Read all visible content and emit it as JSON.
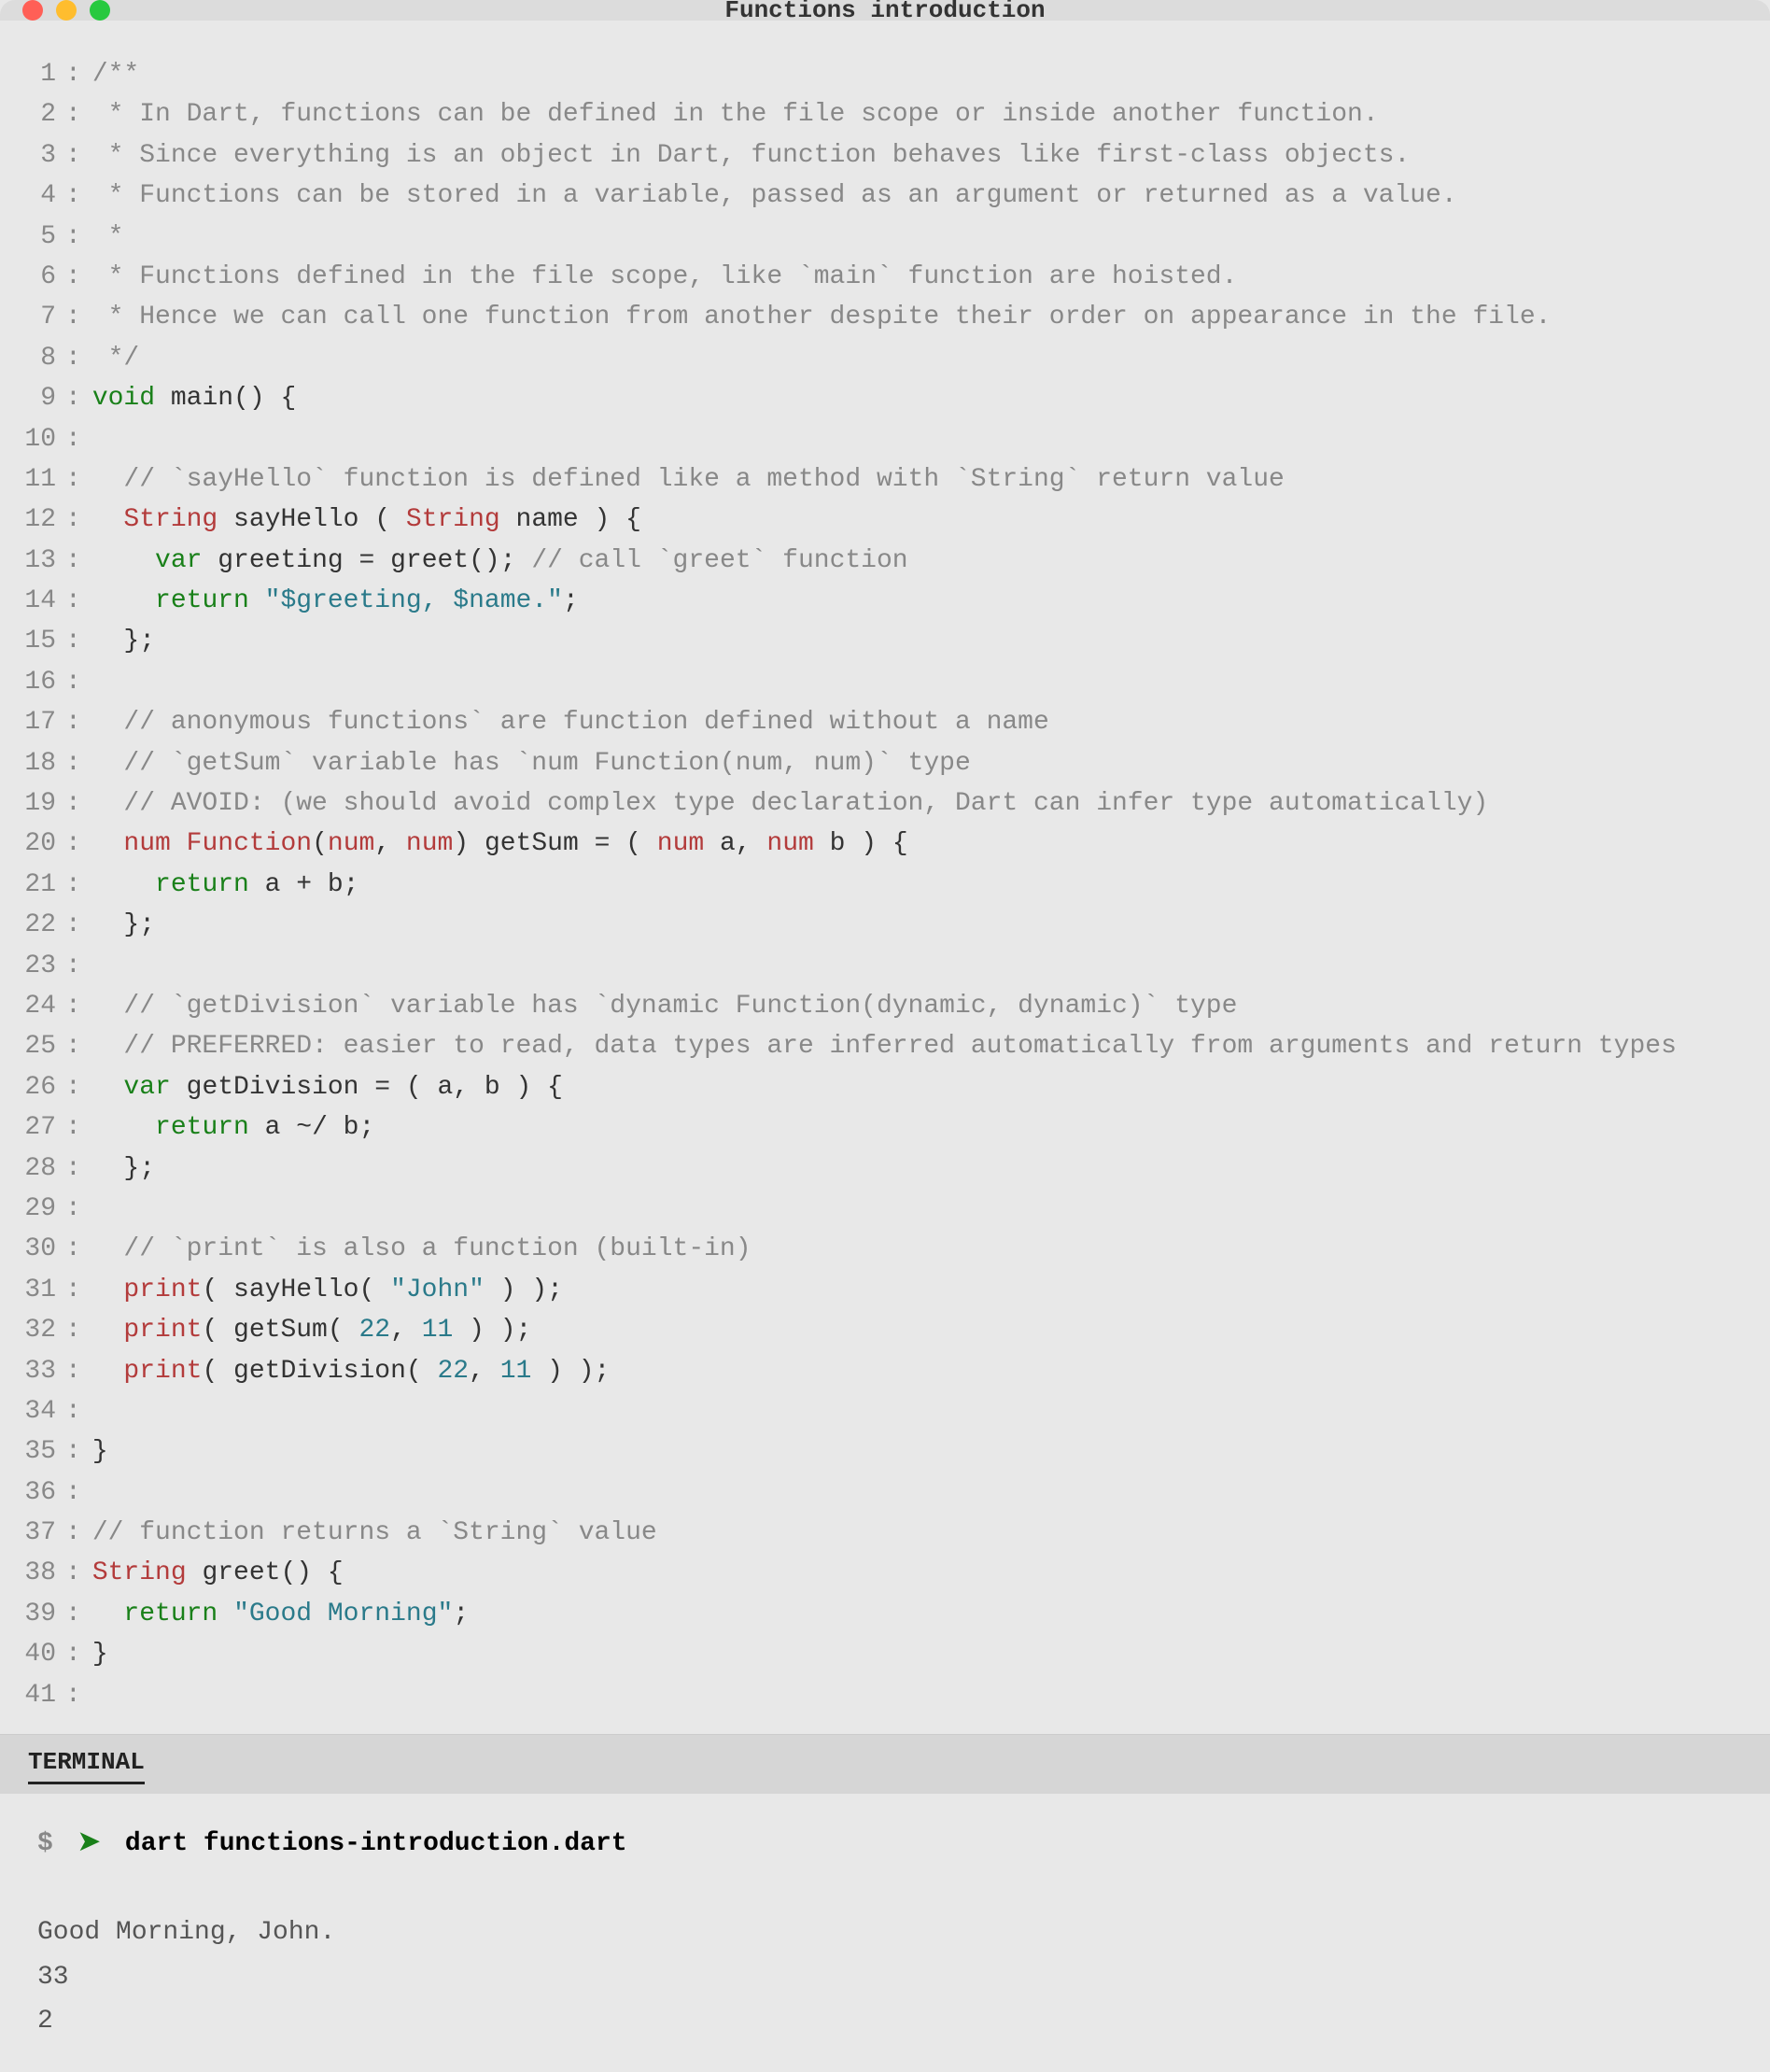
{
  "window": {
    "title": "Functions introduction"
  },
  "code": [
    {
      "n": 1,
      "tokens": [
        [
          "comment",
          "/**"
        ]
      ]
    },
    {
      "n": 2,
      "tokens": [
        [
          "comment",
          " * In Dart, functions can be defined in the file scope or inside another function."
        ]
      ]
    },
    {
      "n": 3,
      "tokens": [
        [
          "comment",
          " * Since everything is an object in Dart, function behaves like first-class objects."
        ]
      ]
    },
    {
      "n": 4,
      "tokens": [
        [
          "comment",
          " * Functions can be stored in a variable, passed as an argument or returned as a value."
        ]
      ]
    },
    {
      "n": 5,
      "tokens": [
        [
          "comment",
          " *"
        ]
      ]
    },
    {
      "n": 6,
      "tokens": [
        [
          "comment",
          " * Functions defined in the file scope, like `main` function are hoisted."
        ]
      ]
    },
    {
      "n": 7,
      "tokens": [
        [
          "comment",
          " * Hence we can call one function from another despite their order on appearance in the file."
        ]
      ]
    },
    {
      "n": 8,
      "tokens": [
        [
          "comment",
          " */"
        ]
      ]
    },
    {
      "n": 9,
      "tokens": [
        [
          "keyword",
          "void"
        ],
        [
          "plain",
          " main() {"
        ]
      ]
    },
    {
      "n": 10,
      "tokens": []
    },
    {
      "n": 11,
      "tokens": [
        [
          "plain",
          "  "
        ],
        [
          "comment",
          "// `sayHello` function is defined like a method with `String` return value"
        ]
      ]
    },
    {
      "n": 12,
      "tokens": [
        [
          "plain",
          "  "
        ],
        [
          "type",
          "String"
        ],
        [
          "plain",
          " sayHello ( "
        ],
        [
          "type",
          "String"
        ],
        [
          "plain",
          " name ) {"
        ]
      ]
    },
    {
      "n": 13,
      "tokens": [
        [
          "plain",
          "    "
        ],
        [
          "keyword",
          "var"
        ],
        [
          "plain",
          " greeting = greet(); "
        ],
        [
          "comment",
          "// call `greet` function"
        ]
      ]
    },
    {
      "n": 14,
      "tokens": [
        [
          "plain",
          "    "
        ],
        [
          "keyword",
          "return"
        ],
        [
          "plain",
          " "
        ],
        [
          "string",
          "\"$greeting, $name.\""
        ],
        [
          "plain",
          ";"
        ]
      ]
    },
    {
      "n": 15,
      "tokens": [
        [
          "plain",
          "  };"
        ]
      ]
    },
    {
      "n": 16,
      "tokens": []
    },
    {
      "n": 17,
      "tokens": [
        [
          "plain",
          "  "
        ],
        [
          "comment",
          "// anonymous functions` are function defined without a name"
        ]
      ]
    },
    {
      "n": 18,
      "tokens": [
        [
          "plain",
          "  "
        ],
        [
          "comment",
          "// `getSum` variable has `num Function(num, num)` type"
        ]
      ]
    },
    {
      "n": 19,
      "tokens": [
        [
          "plain",
          "  "
        ],
        [
          "comment",
          "// AVOID: (we should avoid complex type declaration, Dart can infer type automatically)"
        ]
      ]
    },
    {
      "n": 20,
      "tokens": [
        [
          "plain",
          "  "
        ],
        [
          "type",
          "num"
        ],
        [
          "plain",
          " "
        ],
        [
          "type",
          "Function"
        ],
        [
          "plain",
          "("
        ],
        [
          "type",
          "num"
        ],
        [
          "plain",
          ", "
        ],
        [
          "type",
          "num"
        ],
        [
          "plain",
          ") getSum = ( "
        ],
        [
          "type",
          "num"
        ],
        [
          "plain",
          " a, "
        ],
        [
          "type",
          "num"
        ],
        [
          "plain",
          " b ) {"
        ]
      ]
    },
    {
      "n": 21,
      "tokens": [
        [
          "plain",
          "    "
        ],
        [
          "keyword",
          "return"
        ],
        [
          "plain",
          " a + b;"
        ]
      ]
    },
    {
      "n": 22,
      "tokens": [
        [
          "plain",
          "  };"
        ]
      ]
    },
    {
      "n": 23,
      "tokens": []
    },
    {
      "n": 24,
      "tokens": [
        [
          "plain",
          "  "
        ],
        [
          "comment",
          "// `getDivision` variable has `dynamic Function(dynamic, dynamic)` type"
        ]
      ]
    },
    {
      "n": 25,
      "tokens": [
        [
          "plain",
          "  "
        ],
        [
          "comment",
          "// PREFERRED: easier to read, data types are inferred automatically from arguments and return types"
        ]
      ]
    },
    {
      "n": 26,
      "tokens": [
        [
          "plain",
          "  "
        ],
        [
          "keyword",
          "var"
        ],
        [
          "plain",
          " getDivision = ( a, b ) {"
        ]
      ]
    },
    {
      "n": 27,
      "tokens": [
        [
          "plain",
          "    "
        ],
        [
          "keyword",
          "return"
        ],
        [
          "plain",
          " a ~/ b;"
        ]
      ]
    },
    {
      "n": 28,
      "tokens": [
        [
          "plain",
          "  };"
        ]
      ]
    },
    {
      "n": 29,
      "tokens": []
    },
    {
      "n": 30,
      "tokens": [
        [
          "plain",
          "  "
        ],
        [
          "comment",
          "// `print` is also a function (built-in)"
        ]
      ]
    },
    {
      "n": 31,
      "tokens": [
        [
          "plain",
          "  "
        ],
        [
          "type",
          "print"
        ],
        [
          "plain",
          "( sayHello( "
        ],
        [
          "string",
          "\"John\""
        ],
        [
          "plain",
          " ) );"
        ]
      ]
    },
    {
      "n": 32,
      "tokens": [
        [
          "plain",
          "  "
        ],
        [
          "type",
          "print"
        ],
        [
          "plain",
          "( getSum( "
        ],
        [
          "number",
          "22"
        ],
        [
          "plain",
          ", "
        ],
        [
          "number",
          "11"
        ],
        [
          "plain",
          " ) );"
        ]
      ]
    },
    {
      "n": 33,
      "tokens": [
        [
          "plain",
          "  "
        ],
        [
          "type",
          "print"
        ],
        [
          "plain",
          "( getDivision( "
        ],
        [
          "number",
          "22"
        ],
        [
          "plain",
          ", "
        ],
        [
          "number",
          "11"
        ],
        [
          "plain",
          " ) );"
        ]
      ]
    },
    {
      "n": 34,
      "tokens": []
    },
    {
      "n": 35,
      "tokens": [
        [
          "plain",
          "}"
        ]
      ]
    },
    {
      "n": 36,
      "tokens": []
    },
    {
      "n": 37,
      "tokens": [
        [
          "comment",
          "// function returns a `String` value"
        ]
      ]
    },
    {
      "n": 38,
      "tokens": [
        [
          "type",
          "String"
        ],
        [
          "plain",
          " greet() {"
        ]
      ]
    },
    {
      "n": 39,
      "tokens": [
        [
          "plain",
          "  "
        ],
        [
          "keyword",
          "return"
        ],
        [
          "plain",
          " "
        ],
        [
          "string",
          "\"Good Morning\""
        ],
        [
          "plain",
          ";"
        ]
      ]
    },
    {
      "n": 40,
      "tokens": [
        [
          "plain",
          "}"
        ]
      ]
    },
    {
      "n": 41,
      "tokens": []
    }
  ],
  "terminal": {
    "tab": "TERMINAL",
    "prompt": "$",
    "arrow": "➤",
    "command": "dart functions-introduction.dart",
    "output": [
      "Good Morning, John.",
      "33",
      "2"
    ]
  }
}
